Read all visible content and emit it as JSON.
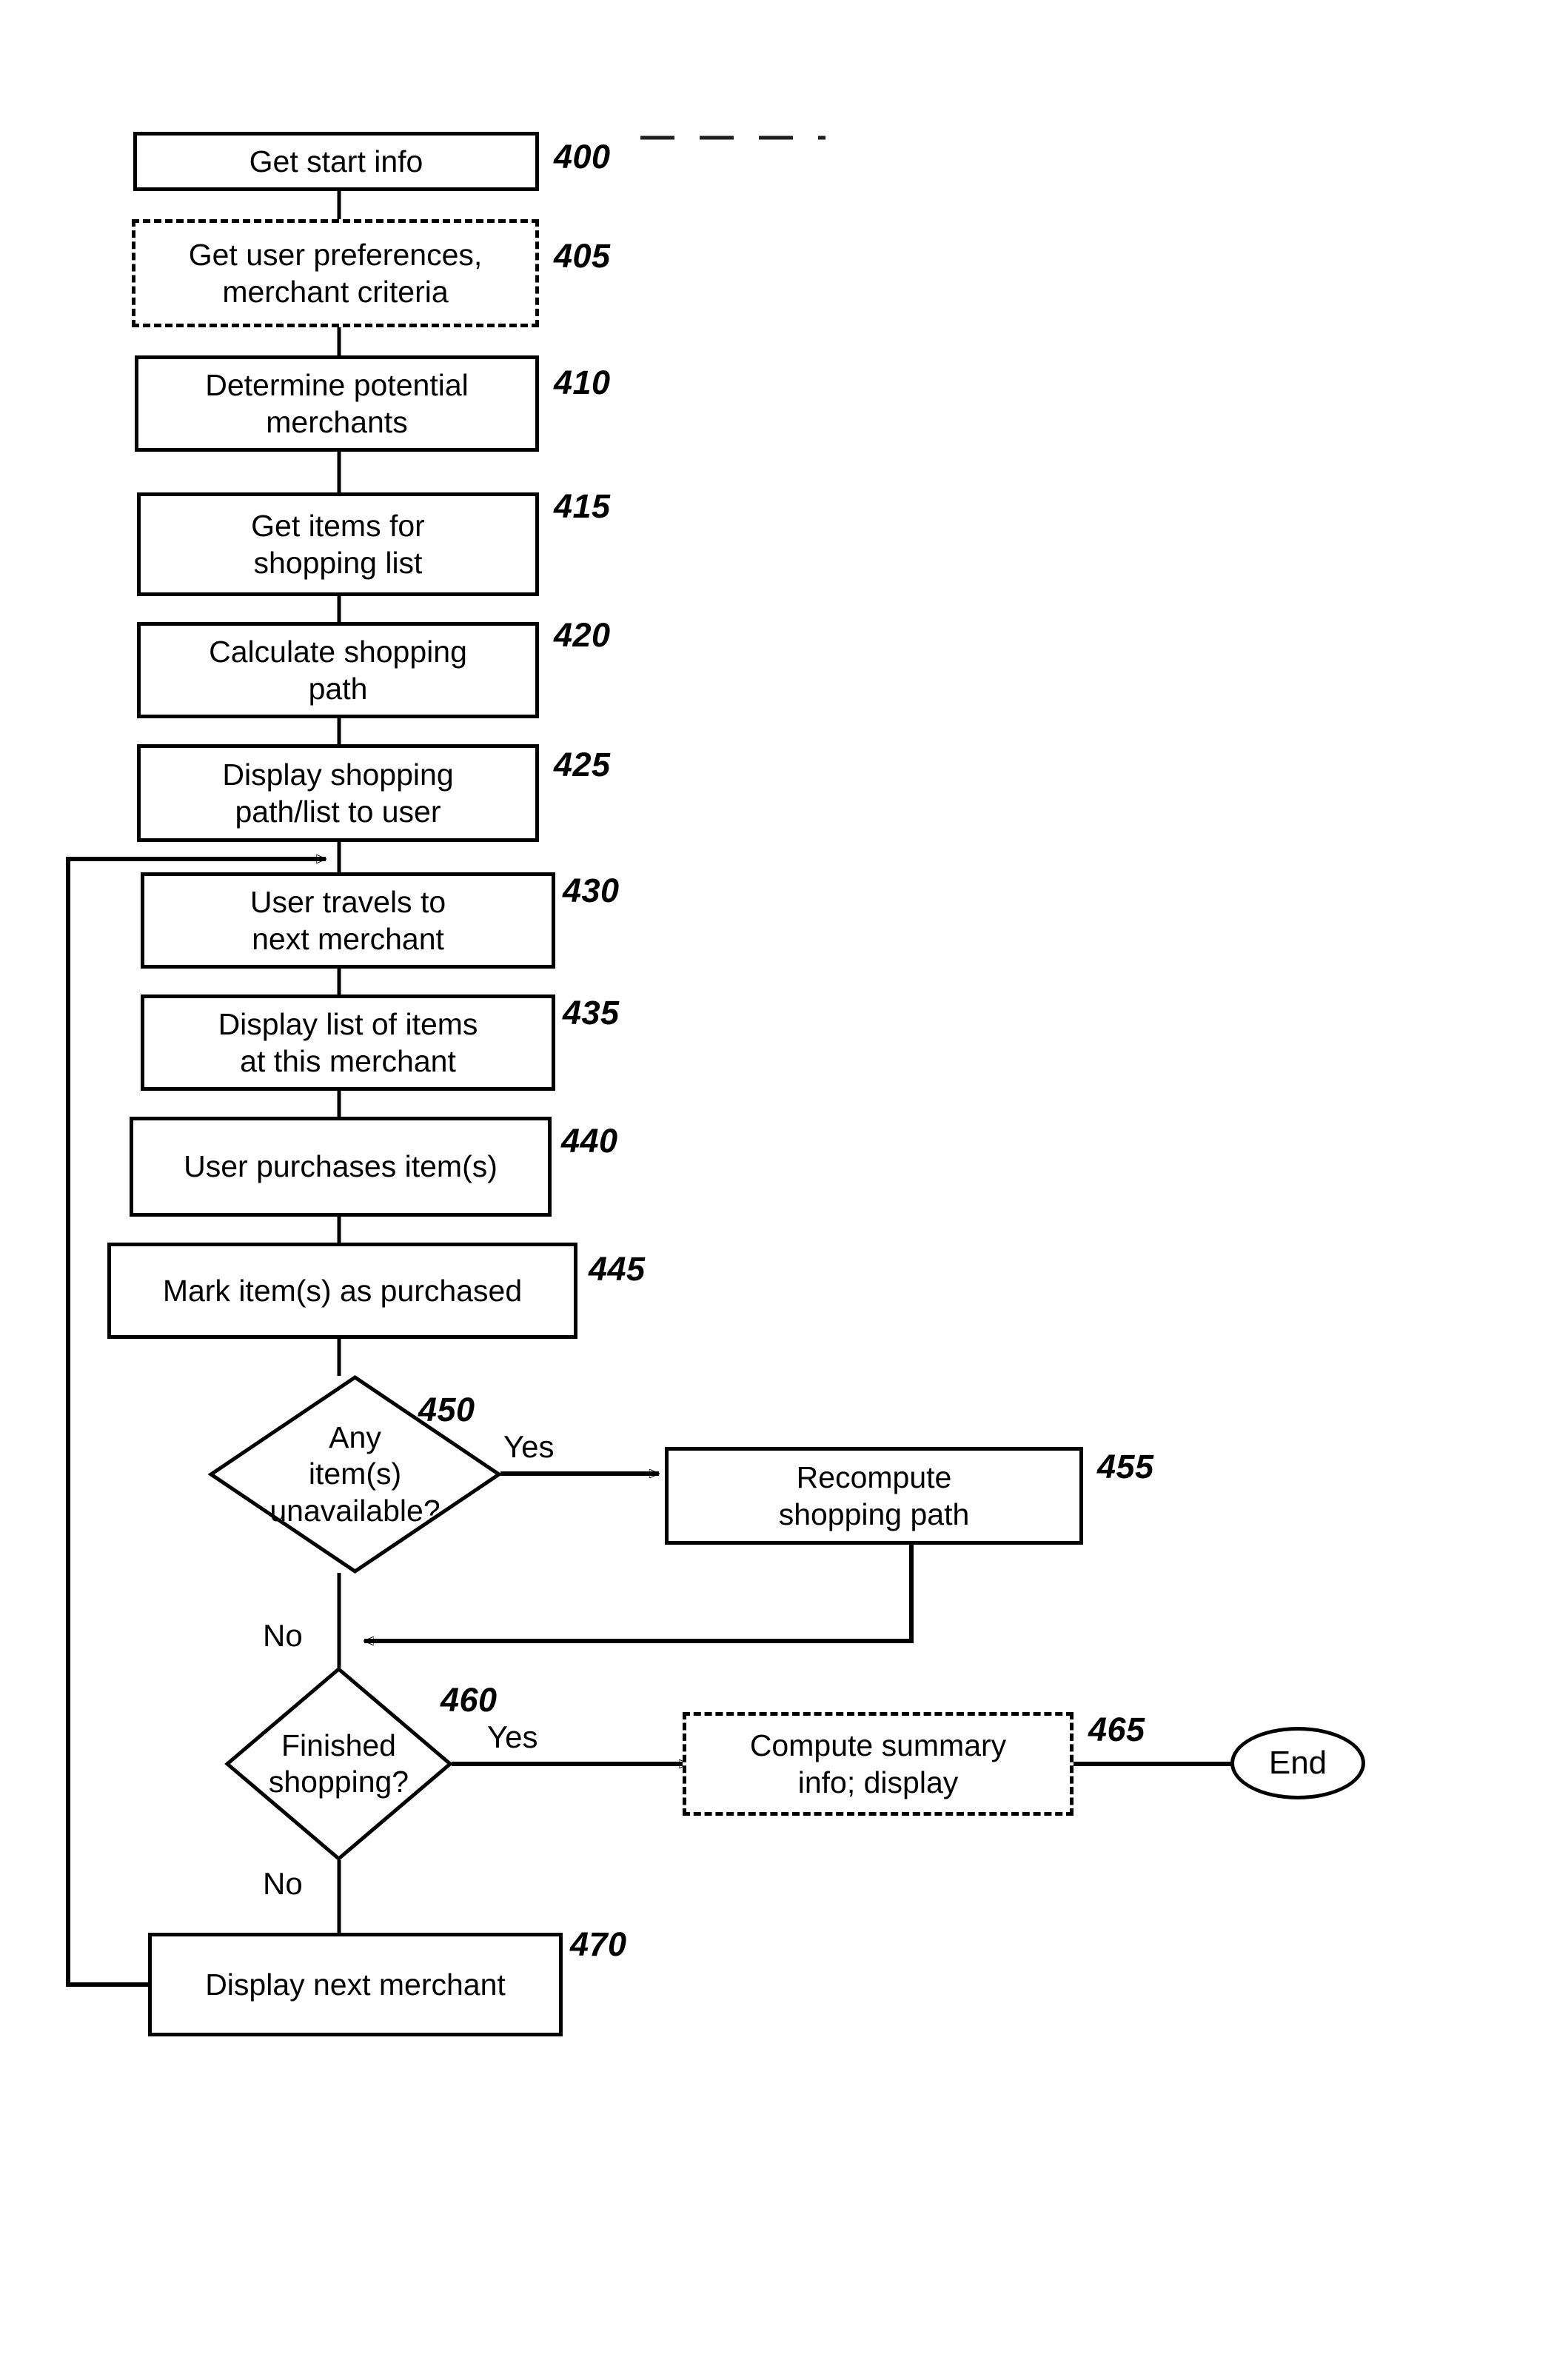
{
  "figure": {
    "type": "flowchart",
    "orientation": "vertical",
    "background_color": "#ffffff",
    "line_color": "#000000"
  },
  "nodes": {
    "n400": {
      "label": "Get start info",
      "ref": "400",
      "shape": "rectangle",
      "border": "solid"
    },
    "n405": {
      "label": "Get user preferences,\nmerchant criteria",
      "ref": "405",
      "shape": "rectangle",
      "border": "dashed"
    },
    "n410": {
      "label": "Determine potential\nmerchants",
      "ref": "410",
      "shape": "rectangle",
      "border": "solid"
    },
    "n415": {
      "label": "Get items for\nshopping list",
      "ref": "415",
      "shape": "rectangle",
      "border": "solid"
    },
    "n420": {
      "label": "Calculate shopping\npath",
      "ref": "420",
      "shape": "rectangle",
      "border": "solid"
    },
    "n425": {
      "label": "Display shopping\npath/list to user",
      "ref": "425",
      "shape": "rectangle",
      "border": "solid"
    },
    "n430": {
      "label": "User travels to\nnext merchant",
      "ref": "430",
      "shape": "rectangle",
      "border": "solid"
    },
    "n435": {
      "label": "Display list of items\nat this merchant",
      "ref": "435",
      "shape": "rectangle",
      "border": "solid"
    },
    "n440": {
      "label": "User purchases item(s)",
      "ref": "440",
      "shape": "rectangle",
      "border": "solid"
    },
    "n445": {
      "label": "Mark item(s) as purchased",
      "ref": "445",
      "shape": "rectangle",
      "border": "solid"
    },
    "n450": {
      "label": "Any\nitem(s)\nunavailable?",
      "ref": "450",
      "shape": "diamond",
      "border": "solid"
    },
    "n455": {
      "label": "Recompute\nshopping path",
      "ref": "455",
      "shape": "rectangle",
      "border": "solid"
    },
    "n460": {
      "label": "Finished\nshopping?",
      "ref": "460",
      "shape": "diamond",
      "border": "solid"
    },
    "n465": {
      "label": "Compute summary\ninfo; display",
      "ref": "465",
      "shape": "rectangle",
      "border": "dashed"
    },
    "n470": {
      "label": "Display next merchant",
      "ref": "470",
      "shape": "rectangle",
      "border": "solid"
    },
    "end": {
      "label": "End",
      "shape": "ellipse",
      "border": "solid"
    }
  },
  "branch_labels": {
    "yes_450": "Yes",
    "no_450": "No",
    "yes_460": "Yes",
    "no_460": "No"
  }
}
